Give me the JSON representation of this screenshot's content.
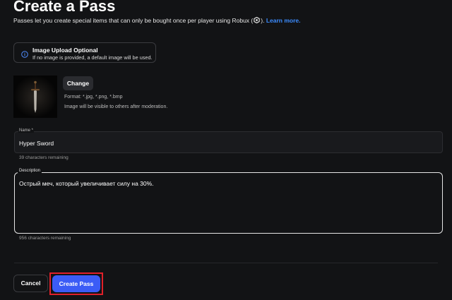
{
  "page": {
    "title": "Create a Pass",
    "subtitle_prefix": "Passes let you create special items that can only be bought once per player using Robux (",
    "subtitle_suffix": ").",
    "learn_more": "Learn more.",
    "robux_icon": "robux-icon"
  },
  "info": {
    "icon": "info-icon",
    "title": "Image Upload Optional",
    "description": "If no image is provided, a default image will be used."
  },
  "image": {
    "thumbnail": "sword-image",
    "change_label": "Change",
    "format_text": "Format: *.jpg, *.png, *.bmp",
    "moderation_text": "Image will be visible to others after moderation."
  },
  "name_field": {
    "label": "Name *",
    "value": "Hyper Sword",
    "remaining": "39 characters remaining"
  },
  "description_field": {
    "label": "Description",
    "value": "Острый меч, который увеличивает силу на 30%.",
    "remaining": "956 characters remaining"
  },
  "actions": {
    "cancel_label": "Cancel",
    "create_label": "Create Pass"
  },
  "colors": {
    "background": "#121315",
    "accent": "#3b5cf6",
    "link": "#3c8cff",
    "highlight": "#e0202a"
  }
}
